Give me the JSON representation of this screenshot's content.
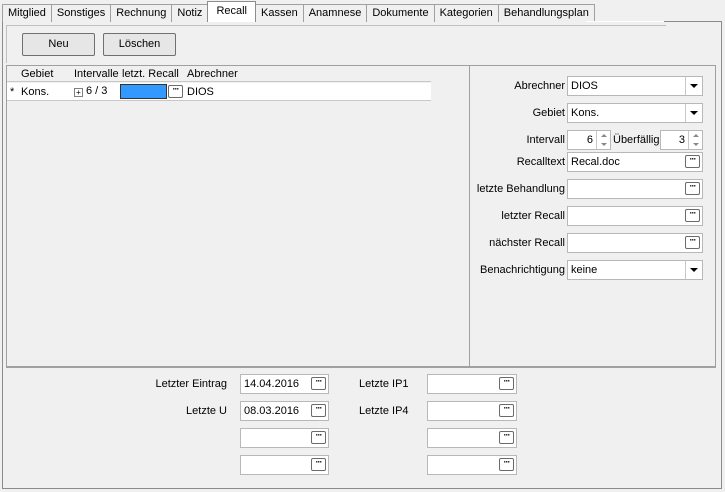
{
  "tabs": [
    {
      "label": "Mitglied"
    },
    {
      "label": "Sonstiges"
    },
    {
      "label": "Rechnung"
    },
    {
      "label": "Notiz"
    },
    {
      "label": "Recall",
      "active": true
    },
    {
      "label": "Kassen"
    },
    {
      "label": "Anamnese"
    },
    {
      "label": "Dokumente"
    },
    {
      "label": "Kategorien"
    },
    {
      "label": "Behandlungsplan"
    }
  ],
  "toolbar": {
    "new_label": "Neu",
    "delete_label": "Löschen"
  },
  "grid": {
    "columns": [
      "Gebiet",
      "Intervalle",
      "letzt. Recall",
      "Abrechner"
    ],
    "row": {
      "marker": "*",
      "gebiet": "Kons.",
      "intervalle": "6 / 3",
      "letzt_recall": "",
      "abrechner": "DIOS"
    }
  },
  "detail": {
    "abrechner_label": "Abrechner",
    "abrechner_value": "DIOS",
    "gebiet_label": "Gebiet",
    "gebiet_value": "Kons.",
    "intervall_label": "Intervall",
    "intervall_value": "6",
    "ueberfaellig_label": "Überfällig",
    "ueberfaellig_value": "3",
    "recalltext_label": "Recalltext",
    "recalltext_value": "Recal.doc",
    "letzte_behandlung_label": "letzte Behandlung",
    "letzte_behandlung_value": "",
    "letzter_recall_label": "letzter Recall",
    "letzter_recall_value": "",
    "naechster_recall_label": "nächster Recall",
    "naechster_recall_value": "",
    "benachrichtigung_label": "Benachrichtigung",
    "benachrichtigung_value": "keine"
  },
  "bottom": {
    "letzter_eintrag_label": "Letzter Eintrag",
    "letzter_eintrag_value": "14.04.2016",
    "letzte_u_label": "Letzte U",
    "letzte_u_value": "08.03.2016",
    "letzte_ip1_label": "Letzte IP1",
    "letzte_ip1_value": "",
    "letzte_ip4_label": "Letzte IP4",
    "letzte_ip4_value": ""
  },
  "colors": {
    "selection": "#3399ff"
  }
}
